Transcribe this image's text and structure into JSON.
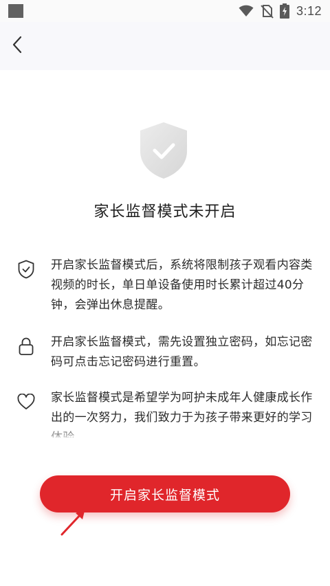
{
  "status_bar": {
    "time": "3:12",
    "icons": [
      "notification-square-icon",
      "wifi-icon",
      "no-sim-icon",
      "battery-charging-icon"
    ]
  },
  "header": {
    "back_icon": "chevron-left-icon"
  },
  "main": {
    "hero_icon": "shield-check-icon",
    "title": "家长监督模式未开启",
    "info_items": [
      {
        "icon": "shield-check-outline-icon",
        "text": "开启家长监督模式后，系统将限制孩子观看内容类视频的时长，单日单设备使用时长累计超过40分钟，会弹出休息提醒。"
      },
      {
        "icon": "lock-icon",
        "text": "开启家长监督模式，需先设置独立密码，如忘记密码可点击忘记密码进行重置。"
      },
      {
        "icon": "heart-icon",
        "text": "家长监督模式是希望学为呵护未成年人健康成长作出的一次努力，我们致力于为孩子带来更好的学习体验。"
      }
    ]
  },
  "cta": {
    "label": "开启家长监督模式"
  },
  "colors": {
    "accent": "#e0262b",
    "hero_shield": "#e3e3e3",
    "annotation_arrow": "#e0262b"
  }
}
